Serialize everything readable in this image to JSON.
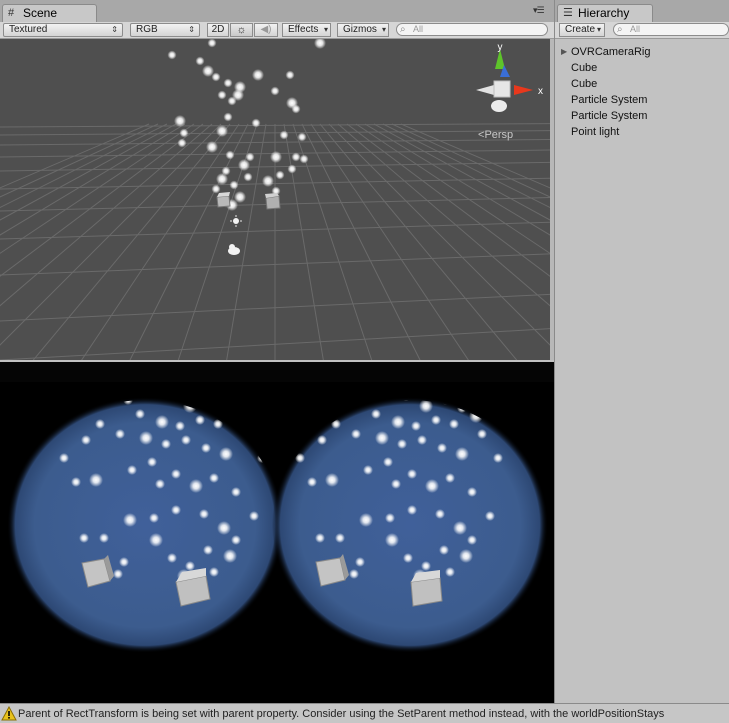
{
  "scene": {
    "tab_label": "Scene",
    "toolbar": {
      "draw_mode": "Textured",
      "render_mode": "RGB",
      "toggle_2d": "2D",
      "effects": "Effects",
      "gizmos": "Gizmos",
      "search_placeholder": "All"
    },
    "gizmo": {
      "axis_y": "y",
      "axis_x": "x",
      "projection": "Persp"
    }
  },
  "hierarchy": {
    "tab_label": "Hierarchy",
    "create_label": "Create",
    "search_placeholder": "All",
    "items": [
      {
        "label": "OVRCameraRig",
        "has_children": true
      },
      {
        "label": "Cube",
        "has_children": false
      },
      {
        "label": "Cube",
        "has_children": false
      },
      {
        "label": "Particle System",
        "has_children": false
      },
      {
        "label": "Particle System",
        "has_children": false
      },
      {
        "label": "Point light",
        "has_children": false
      }
    ]
  },
  "status": {
    "message": "Parent of RectTransform is being set with parent property. Consider using the SetParent method instead, with the worldPositionStays"
  },
  "colors": {
    "scene_background": "#4f4f4f",
    "game_lens_blue": "#3c5c8e",
    "axis_x": "#e8381c",
    "axis_y": "#5ec42a",
    "axis_z": "#3a6ed8"
  },
  "icons": {
    "scene_tab": "grid-icon",
    "hierarchy_tab": "list-icon",
    "lighting_toggle": "sun-icon",
    "audio_toggle": "speaker-icon",
    "status": "warning-icon"
  }
}
